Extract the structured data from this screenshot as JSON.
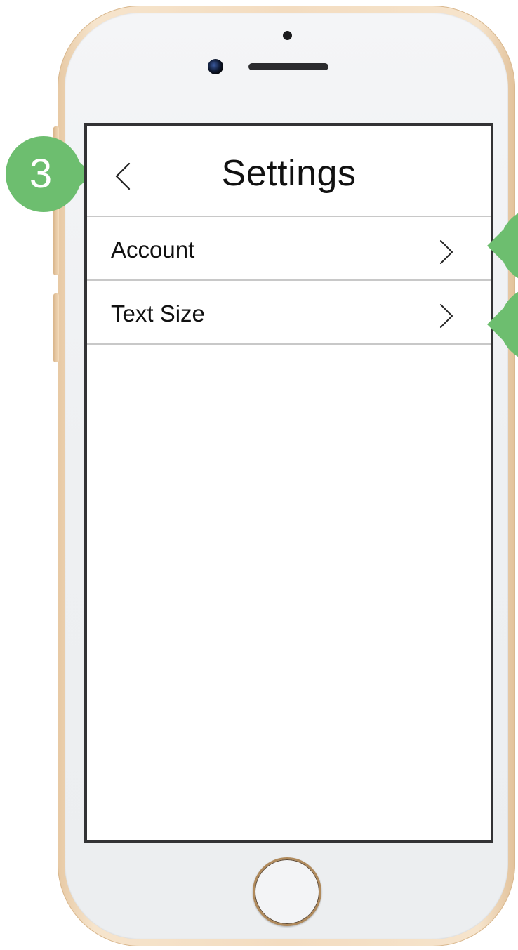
{
  "screen": {
    "title": "Settings",
    "back_icon": "chevron-left-icon",
    "items": [
      {
        "label": "Account",
        "icon": "chevron-right-icon"
      },
      {
        "label": "Text Size",
        "icon": "chevron-right-icon"
      }
    ]
  },
  "annotations": {
    "marker_label": "3",
    "marker_color": "#6dbe6f"
  },
  "colors": {
    "divider": "#c8c8c8",
    "screen_border": "#333335",
    "frame_gold": "#f3dcc0"
  }
}
